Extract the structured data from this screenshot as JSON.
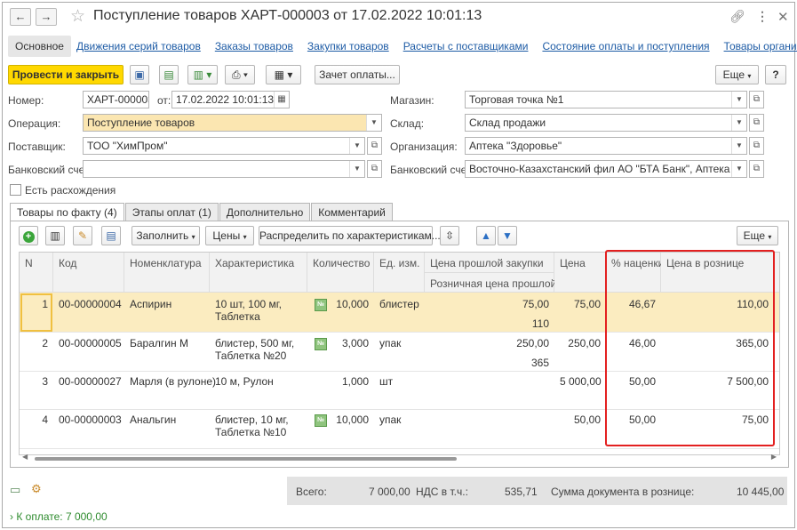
{
  "window": {
    "title": "Поступление товаров ХАРТ-000003 от 17.02.2022 10:01:13",
    "back_icon": "arrow-left-icon",
    "forward_icon": "arrow-right-icon",
    "star_icon": "star-icon"
  },
  "top_tabs": {
    "main": "Основное",
    "links": [
      "Движения серий товаров",
      "Заказы товаров",
      "Закупки товаров",
      "Расчеты с поставщиками",
      "Состояние оплаты и поступления",
      "Товары организаций"
    ]
  },
  "toolbar": {
    "post_close": "Провести и закрыть",
    "offset_payment": "Зачет оплаты...",
    "more": "Еще",
    "help": "?"
  },
  "form": {
    "number_label": "Номер:",
    "number_value": "ХАРТ-000003",
    "from_label": "от:",
    "date_value": "17.02.2022 10:01:13",
    "operation_label": "Операция:",
    "operation_value": "Поступление товаров",
    "supplier_label": "Поставщик:",
    "supplier_value": "ТОО \"ХимПром\"",
    "bank_label": "Банковский счет:",
    "bank_value": "",
    "discrepancy_label": "Есть расхождения",
    "store_label": "Магазин:",
    "store_value": "Торговая точка №1",
    "warehouse_label": "Склад:",
    "warehouse_value": "Склад продажи",
    "org_label": "Организация:",
    "org_value": "Аптека \"Здоровье\"",
    "bank2_label": "Банковский счет:",
    "bank2_value": "Восточно-Казахстанский фил АО \"БТА Банк\", Аптека \"Здоровь"
  },
  "inner_tabs": [
    "Товары по факту (4)",
    "Этапы оплат (1)",
    "Дополнительно",
    "Комментарий"
  ],
  "grid_toolbar": {
    "fill": "Заполнить",
    "prices": "Цены",
    "distribute": "Распределить по характеристикам...",
    "more": "Еще"
  },
  "columns": {
    "n": "N",
    "code": "Код",
    "item": "Номенклатура",
    "char": "Характеристика",
    "qty": "Количество",
    "unit": "Ед. изм.",
    "last_price": "Цена прошлой закупки",
    "retail_last": "Розничная цена прошлой",
    "price": "Цена",
    "markup": "% наценки",
    "retail_price": "Цена в рознице"
  },
  "rows": [
    {
      "n": "1",
      "code": "00-00000004",
      "item": "Аспирин",
      "char1": "10 шт, 100 мг,",
      "char2": "Таблетка",
      "qty": "10,000",
      "unit": "блистер",
      "last": "75,00",
      "retail_last": "110",
      "price": "75,00",
      "markup": "46,67",
      "retail": "110,00"
    },
    {
      "n": "2",
      "code": "00-00000005",
      "item": "Баралгин М",
      "char1": "блистер, 500 мг,",
      "char2": "Таблетка №20",
      "qty": "3,000",
      "unit": "упак",
      "last": "250,00",
      "retail_last": "365",
      "price": "250,00",
      "markup": "46,00",
      "retail": "365,00"
    },
    {
      "n": "3",
      "code": "00-00000027",
      "item": "Марля (в рулоне)",
      "char1": "10 м, Рулон",
      "char2": "",
      "qty": "1,000",
      "unit": "шт",
      "last": "",
      "retail_last": "",
      "price": "5 000,00",
      "markup": "50,00",
      "retail": "7 500,00"
    },
    {
      "n": "4",
      "code": "00-00000003",
      "item": "Анальгин",
      "char1": "блистер, 10 мг,",
      "char2": "Таблетка №10",
      "qty": "10,000",
      "unit": "упак",
      "last": "",
      "retail_last": "",
      "price": "50,00",
      "markup": "50,00",
      "retail": "75,00"
    }
  ],
  "totals": {
    "total_label": "Всего:",
    "total_value": "7 000,00",
    "vat_label": "НДС в т.ч.:",
    "vat_value": "535,71",
    "retail_label": "Сумма документа в рознице:",
    "retail_value": "10 445,00"
  },
  "payment_link": "К оплате: 7 000,00",
  "nb_badge": "№"
}
